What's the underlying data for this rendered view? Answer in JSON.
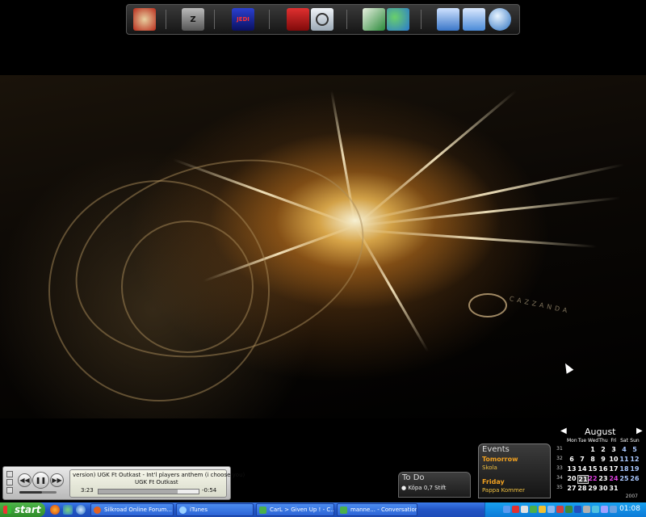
{
  "dock": {
    "items": [
      {
        "name": "Silkroad Online",
        "icon": "silkroad-icon",
        "color": "#b82a1a"
      },
      {
        "name": "Z",
        "icon": "zeta-icon",
        "color": "#8a8a8a"
      },
      {
        "name": "JEDI",
        "icon": "jedi-icon",
        "color": "#1a2a9c"
      },
      {
        "name": "PDF",
        "icon": "acrobat-icon",
        "color": "#b01818"
      },
      {
        "name": "Speaker",
        "icon": "speaker-icon",
        "color": "#cfd8e0"
      },
      {
        "name": "Feather",
        "icon": "quill-icon",
        "color": "#2a8a3a"
      },
      {
        "name": "MSN",
        "icon": "messenger-icon",
        "color": "#3a9a3a"
      },
      {
        "name": "Documents",
        "icon": "documents-icon",
        "color": "#3a76c8"
      },
      {
        "name": "My Computer",
        "icon": "computer-icon",
        "color": "#4a8ad8"
      },
      {
        "name": "Internet",
        "icon": "globe-icon",
        "color": "#2a70c0"
      }
    ]
  },
  "wallpaper": {
    "watermark": "CAZZANDA"
  },
  "player": {
    "track_line1": "version)   UGK Ft Outkast - Int'l players anthem (i choose you)",
    "track_line2": "UGK Ft Outkast",
    "elapsed": "3:23",
    "remaining": "-0:54",
    "progress": 0.79,
    "volume": 0.6
  },
  "todo": {
    "title": "To Do",
    "item": "Köpa 0,7 Stift"
  },
  "events": {
    "title": "Events",
    "items": [
      {
        "when": "Tomorrow",
        "what": "Skola"
      },
      {
        "when": "Friday",
        "what": "Pappa Kommer"
      }
    ]
  },
  "calendar": {
    "month": "August",
    "year": "2007",
    "weekdays": [
      "Mon",
      "Tue",
      "Wed",
      "Thu",
      "Fri",
      "Sat",
      "Sun"
    ],
    "weeks": [
      {
        "wk": "31",
        "days": [
          "",
          "",
          "1",
          "2",
          "3",
          "4",
          "5"
        ]
      },
      {
        "wk": "32",
        "days": [
          "6",
          "7",
          "8",
          "9",
          "10",
          "11",
          "12"
        ]
      },
      {
        "wk": "33",
        "days": [
          "13",
          "14",
          "15",
          "16",
          "17",
          "18",
          "19"
        ]
      },
      {
        "wk": "34",
        "days": [
          "20",
          "21",
          "22",
          "23",
          "24",
          "25",
          "26"
        ]
      },
      {
        "wk": "35",
        "days": [
          "27",
          "28",
          "29",
          "30",
          "31",
          "",
          ""
        ]
      }
    ],
    "today": "21",
    "highlight_color": "#e040e0"
  },
  "taskbar": {
    "start_label": "start",
    "buttons": [
      {
        "label": "Silkroad Online Forum...",
        "icon": "firefox-icon"
      },
      {
        "label": "iTunes",
        "icon": "itunes-icon"
      },
      {
        "label": "CarL > Given Up ! - C...",
        "icon": "messenger-icon"
      },
      {
        "label": "manne... - Conversation",
        "icon": "messenger-icon"
      }
    ],
    "clock": "01:08"
  }
}
